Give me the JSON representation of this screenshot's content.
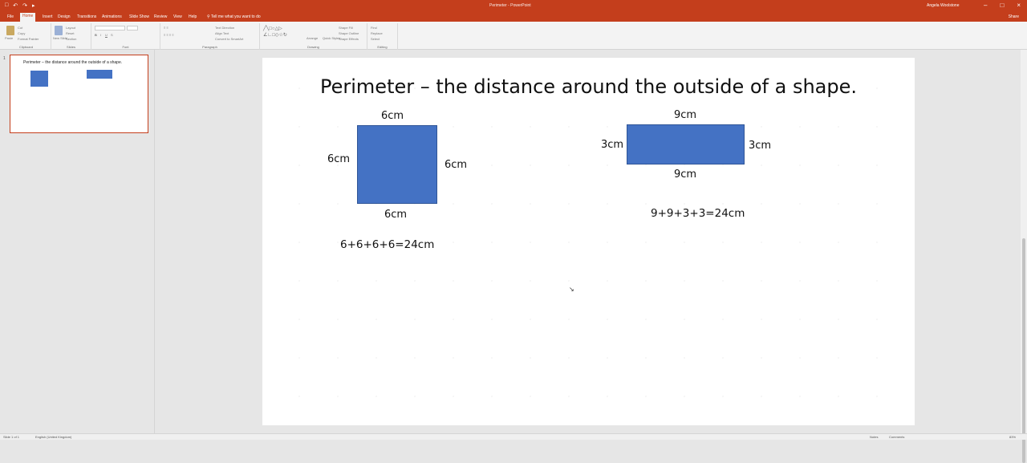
{
  "window": {
    "title": "Perimeter - PowerPoint",
    "user": "Angela Woolstone",
    "brand_color": "#c43e1c"
  },
  "quick_access": [
    "save-icon",
    "undo-icon",
    "redo-icon",
    "present-icon"
  ],
  "tabs": [
    "File",
    "Home",
    "Insert",
    "Design",
    "Transitions",
    "Animations",
    "Slide Show",
    "Review",
    "View",
    "Help"
  ],
  "tell_me": "Tell me what you want to do",
  "share_label": "Share",
  "ribbon": {
    "groups": [
      "Clipboard",
      "Slides",
      "Font",
      "Paragraph",
      "Drawing",
      "Editing"
    ],
    "clipboard": {
      "paste": "Paste",
      "cut": "Cut",
      "copy": "Copy",
      "format_painter": "Format Painter"
    },
    "slides": {
      "new_slide": "New Slide",
      "layout": "Layout",
      "reset": "Reset",
      "section": "Section"
    },
    "drawing": {
      "arrange": "Arrange",
      "quick_styles": "Quick Styles",
      "shape_fill": "Shape Fill",
      "shape_outline": "Shape Outline",
      "shape_effects": "Shape Effects"
    },
    "editing": {
      "find": "Find",
      "replace": "Replace",
      "select": "Select"
    },
    "paragraph": {
      "text_direction": "Text Direction",
      "align_text": "Align Text",
      "convert_smartart": "Convert to SmartArt"
    }
  },
  "thumbnail": {
    "number": "1",
    "title": "Perimeter – the distance around the outside of a shape."
  },
  "slide": {
    "title": "Perimeter – the distance around the outside of a shape.",
    "square": {
      "top": "6cm",
      "left": "6cm",
      "right": "6cm",
      "bottom": "6cm",
      "sum": "6+6+6+6=24cm",
      "color": "#4472c4"
    },
    "rectangle": {
      "top": "9cm",
      "left": "3cm",
      "right": "3cm",
      "bottom": "9cm",
      "sum": "9+9+3+3=24cm",
      "color": "#4472c4"
    }
  },
  "status": {
    "slide_count": "Slide 1 of 1",
    "language": "English (United Kingdom)",
    "notes": "Notes",
    "comments": "Comments",
    "zoom": "83%"
  }
}
